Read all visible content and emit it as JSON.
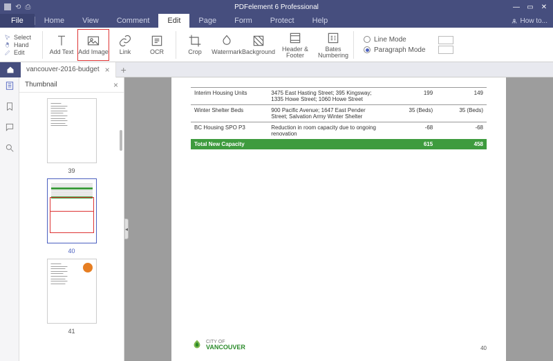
{
  "app": {
    "title": "PDFelement 6 Professional",
    "howto": "How to..."
  },
  "menu": {
    "file": "File",
    "home": "Home",
    "view": "View",
    "comment": "Comment",
    "edit": "Edit",
    "page": "Page",
    "form": "Form",
    "protect": "Protect",
    "help": "Help"
  },
  "ribbon": {
    "select": "Select",
    "hand": "Hand",
    "edit": "Edit",
    "addtext": "Add Text",
    "addimage": "Add Image",
    "link": "Link",
    "ocr": "OCR",
    "crop": "Crop",
    "watermark": "Watermark",
    "background": "Background",
    "headerfooter": "Header & Footer",
    "bates": "Bates\nNumbering",
    "linemode": "Line Mode",
    "paramode": "Paragraph Mode"
  },
  "tabs": {
    "doc": "vancouver-2016-budget"
  },
  "panel": {
    "title": "Thumbnail",
    "p39": "39",
    "p40": "40",
    "p41": "41"
  },
  "doc": {
    "rows": [
      {
        "c1": "Interim Housing Units",
        "c2": "3475 East Hasting Street; 395 Kingsway; 1335 Howe Street; 1060 Howe Street",
        "c3": "199",
        "c4": "149"
      },
      {
        "c1": "Winter Shelter Beds",
        "c2": "900 Pacific Avenue; 1647 East Pender Street; Salvation Army Winter Shelter",
        "c3": "35 (Beds)",
        "c4": "35 (Beds)"
      },
      {
        "c1": "BC Housing SPO P3",
        "c2": "Reduction in room capacity due to ongoing renovation",
        "c3": "-68",
        "c4": "-68"
      }
    ],
    "total": {
      "label": "Total New Capacity",
      "c3": "615",
      "c4": "458"
    },
    "logo": {
      "line1": "CITY OF",
      "line2": "VANCOUVER"
    },
    "pagenum": "40"
  }
}
